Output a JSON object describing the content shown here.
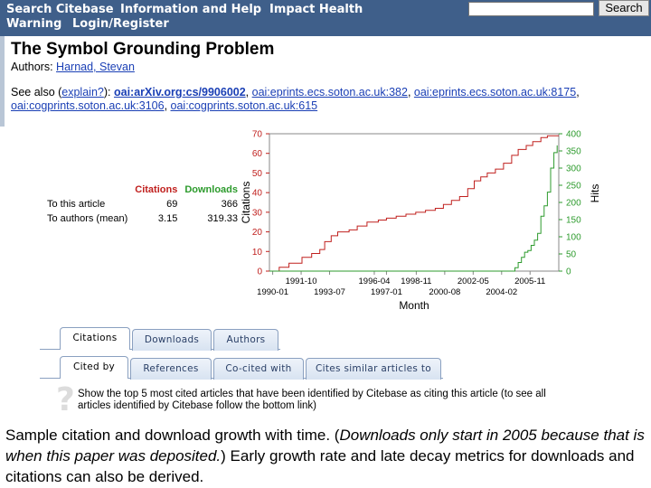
{
  "nav": {
    "items": [
      {
        "label": "Search Citebase"
      },
      {
        "label": "Information and Help"
      },
      {
        "label": "Impact Health"
      },
      {
        "label": "Warning"
      },
      {
        "label": "Login/Register"
      }
    ],
    "search": {
      "value": "",
      "button_label": "Search"
    }
  },
  "article": {
    "title": "The Symbol Grounding Problem",
    "authors_label": "Authors:",
    "author": "Harnad, Stevan",
    "seealso_prefix": "See also (",
    "explain_link": "explain?",
    "seealso_colon": "):",
    "links": [
      "oai:arXiv.org:cs/9906002",
      "oai:eprints.ecs.soton.ac.uk:382",
      "oai:eprints.ecs.soton.ac.uk:8175",
      "oai:cogprints.soton.ac.uk:3106",
      "oai:cogprints.soton.ac.uk:615"
    ]
  },
  "stats": {
    "col_citations": "Citations",
    "col_downloads": "Downloads",
    "rows": [
      {
        "label": "To this article",
        "citations": "69",
        "downloads": "366"
      },
      {
        "label": "To authors (mean)",
        "citations": "3.15",
        "downloads": "319.33"
      }
    ]
  },
  "chart_data": {
    "type": "line",
    "xlabel": "Month",
    "ylabel_left": "Citations",
    "ylabel_right": "Hits",
    "ylim_left": [
      0,
      70
    ],
    "ylim_right": [
      0,
      400
    ],
    "yticks_left": [
      "0",
      "10",
      "20",
      "30",
      "40",
      "50",
      "60",
      "70"
    ],
    "yticks_right": [
      "0",
      "50",
      "100",
      "150",
      "200",
      "250",
      "300",
      "350",
      "400"
    ],
    "xticks_top": [
      "1991-10",
      "1996-04",
      "1998-11",
      "2002-05",
      "2005-11"
    ],
    "xticks_bottom": [
      "1990-01",
      "1993-07",
      "1997-01",
      "2000-08",
      "2004-02"
    ],
    "x_range": [
      1989.8,
      2007.6
    ],
    "grid": false,
    "series": [
      {
        "name": "Citations",
        "color": "#c0201e",
        "axis": "left",
        "points": [
          [
            1989.8,
            0
          ],
          [
            1990.4,
            2
          ],
          [
            1991.0,
            4
          ],
          [
            1991.8,
            7
          ],
          [
            1992.4,
            9
          ],
          [
            1992.9,
            11
          ],
          [
            1993.2,
            15
          ],
          [
            1993.6,
            18
          ],
          [
            1994.0,
            20
          ],
          [
            1994.7,
            21
          ],
          [
            1995.2,
            23
          ],
          [
            1995.8,
            25
          ],
          [
            1996.5,
            26
          ],
          [
            1997.0,
            27
          ],
          [
            1997.6,
            28
          ],
          [
            1998.2,
            29
          ],
          [
            1998.8,
            30
          ],
          [
            1999.4,
            31
          ],
          [
            2000.0,
            32
          ],
          [
            2000.5,
            34
          ],
          [
            2001.0,
            36
          ],
          [
            2001.5,
            38
          ],
          [
            2002.0,
            42
          ],
          [
            2002.4,
            46
          ],
          [
            2002.8,
            48
          ],
          [
            2003.2,
            50
          ],
          [
            2003.7,
            52
          ],
          [
            2004.2,
            55
          ],
          [
            2004.7,
            59
          ],
          [
            2005.1,
            62
          ],
          [
            2005.6,
            64
          ],
          [
            2006.0,
            66
          ],
          [
            2006.5,
            68
          ],
          [
            2006.9,
            69
          ],
          [
            2007.6,
            69
          ]
        ]
      },
      {
        "name": "Downloads",
        "color": "#2d9b2d",
        "axis": "right",
        "points": [
          [
            1989.8,
            0
          ],
          [
            2004.7,
            0
          ],
          [
            2004.9,
            10
          ],
          [
            2005.1,
            25
          ],
          [
            2005.3,
            40
          ],
          [
            2005.5,
            55
          ],
          [
            2005.7,
            60
          ],
          [
            2005.9,
            75
          ],
          [
            2006.1,
            90
          ],
          [
            2006.3,
            110
          ],
          [
            2006.5,
            160
          ],
          [
            2006.7,
            190
          ],
          [
            2006.9,
            230
          ],
          [
            2007.1,
            300
          ],
          [
            2007.3,
            345
          ],
          [
            2007.5,
            366
          ]
        ]
      }
    ]
  },
  "tabs_row1": [
    "Citations",
    "Downloads",
    "Authors"
  ],
  "tabs_row2": [
    "Cited by",
    "References",
    "Co-cited with",
    "Cites similar articles to"
  ],
  "help": {
    "icon": "question-mark-icon",
    "text": "Show the top 5 most cited articles that have been identified by Citebase as citing this article (to see all articles identified by Citebase follow the bottom link)"
  },
  "caption": {
    "part1": "Sample citation and download growth with time. (",
    "italic": "Downloads only start in 2005 because that is when this paper was deposited.",
    "part2": ") Early growth rate and late decay metrics for downloads and citations can also be derived."
  }
}
